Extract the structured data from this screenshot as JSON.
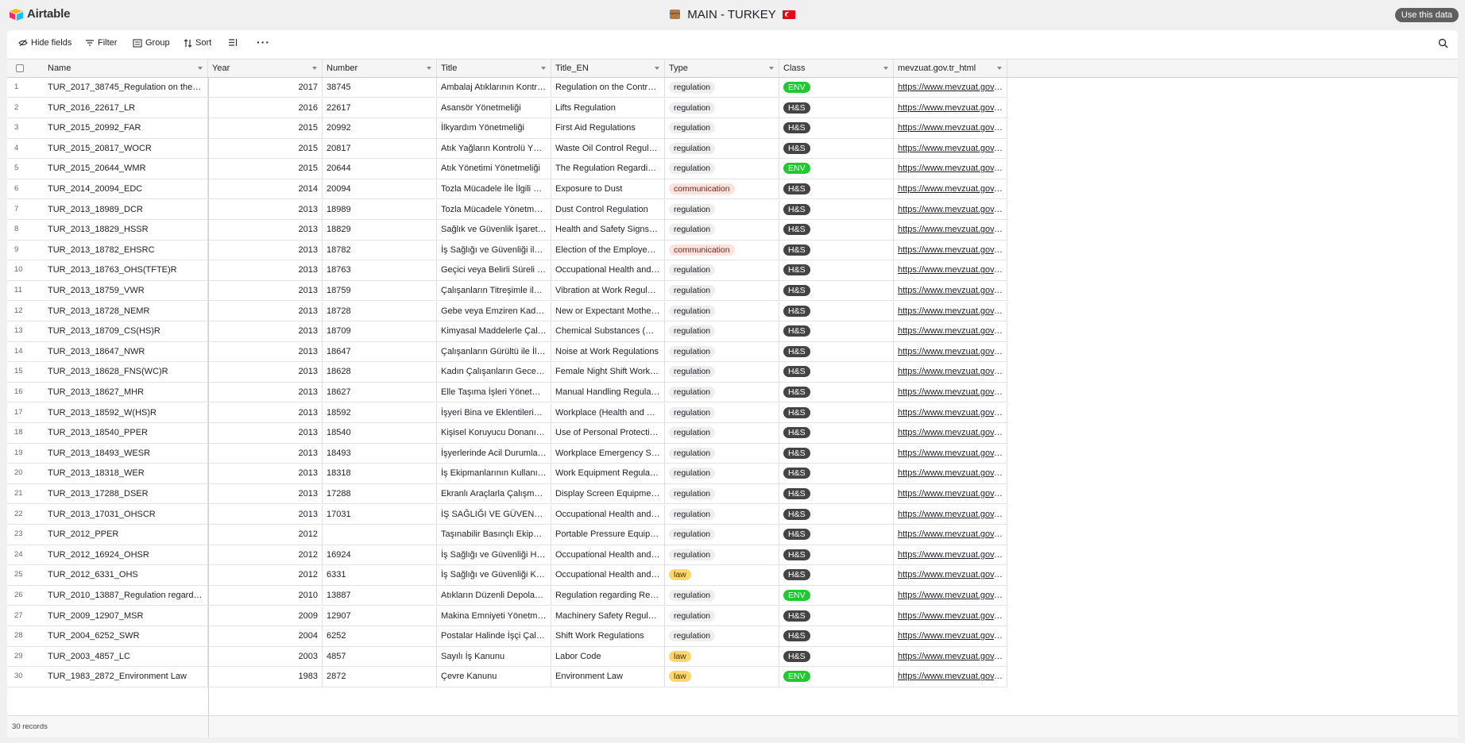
{
  "app": {
    "logo_text": "Airtable"
  },
  "base": {
    "title": "MAIN - TURKEY",
    "use_data_label": "Use this data"
  },
  "toolbar": {
    "hide_fields": "Hide fields",
    "filter": "Filter",
    "group": "Group",
    "sort": "Sort"
  },
  "table": {
    "columns": [
      "Name",
      "Year",
      "Number",
      "Title",
      "Title_EN",
      "Type",
      "Class",
      "mevzuat.gov.tr_html"
    ],
    "rows": [
      {
        "n": "1",
        "name": "TUR_2017_38745_Regulation on the Co...",
        "year": "2017",
        "number": "38745",
        "title": "Ambalaj Atıklarının Kontrol...",
        "title_en": "Regulation on the Control o...",
        "type": "regulation",
        "class": "ENV",
        "url": "https://www.mevzuat.gov.t..."
      },
      {
        "n": "2",
        "name": "TUR_2016_22617_LR",
        "year": "2016",
        "number": "22617",
        "title": "Asansör Yönetmeliği",
        "title_en": "Lifts Regulation",
        "type": "regulation",
        "class": "H&S",
        "url": "https://www.mevzuat.gov.t..."
      },
      {
        "n": "3",
        "name": "TUR_2015_20992_FAR",
        "year": "2015",
        "number": "20992",
        "title": "İlkyardım Yönetmeliği",
        "title_en": "First Aid Regulations",
        "type": "regulation",
        "class": "H&S",
        "url": "https://www.mevzuat.gov.t..."
      },
      {
        "n": "4",
        "name": "TUR_2015_20817_WOCR",
        "year": "2015",
        "number": "20817",
        "title": "Atık Yağların Kontrolü Yöne...",
        "title_en": "Waste Oil Control Regulation",
        "type": "regulation",
        "class": "H&S",
        "url": "https://www.mevzuat.gov.t..."
      },
      {
        "n": "5",
        "name": "TUR_2015_20644_WMR",
        "year": "2015",
        "number": "20644",
        "title": "Atık Yönetimi Yönetmeliği",
        "title_en": "The Regulation Regarding t...",
        "type": "regulation",
        "class": "ENV",
        "url": "https://www.mevzuat.gov.t..."
      },
      {
        "n": "6",
        "name": "TUR_2014_20094_EDC",
        "year": "2014",
        "number": "20094",
        "title": "Tozla Mücadele İle İlgili Uy...",
        "title_en": "Exposure to Dust",
        "type": "communication",
        "class": "H&S",
        "url": "https://www.mevzuat.gov.t..."
      },
      {
        "n": "7",
        "name": "TUR_2013_18989_DCR",
        "year": "2013",
        "number": "18989",
        "title": "Tozla Mücadele Yönetmeliği",
        "title_en": "Dust Control Regulation",
        "type": "regulation",
        "class": "H&S",
        "url": "https://www.mevzuat.gov.t..."
      },
      {
        "n": "8",
        "name": "TUR_2013_18829_HSSR",
        "year": "2013",
        "number": "18829",
        "title": "Sağlık ve Güvenlik İşaretleri...",
        "title_en": "Health and Safety Signs Re...",
        "type": "regulation",
        "class": "H&S",
        "url": "https://www.mevzuat.gov.t..."
      },
      {
        "n": "9",
        "name": "TUR_2013_18782_EHSRC",
        "year": "2013",
        "number": "18782",
        "title": "İş Sağlığı ve Güvenliği ile il...",
        "title_en": "Election of the Employee H...",
        "type": "communication",
        "class": "H&S",
        "url": "https://www.mevzuat.gov.t..."
      },
      {
        "n": "10",
        "name": "TUR_2013_18763_OHS(TFTE)R",
        "year": "2013",
        "number": "18763",
        "title": "Geçici veya Belirli Süreli İşl...",
        "title_en": "Occupational Health and S...",
        "type": "regulation",
        "class": "H&S",
        "url": "https://www.mevzuat.gov.t..."
      },
      {
        "n": "11",
        "name": "TUR_2013_18759_VWR",
        "year": "2013",
        "number": "18759",
        "title": "Çalışanların Titreşimle ilgili...",
        "title_en": "Vibration at Work Regulatio...",
        "type": "regulation",
        "class": "H&S",
        "url": "https://www.mevzuat.gov.t..."
      },
      {
        "n": "12",
        "name": "TUR_2013_18728_NEMR",
        "year": "2013",
        "number": "18728",
        "title": "Gebe veya Emziren Kadınla...",
        "title_en": "New or Expectant Mothers ...",
        "type": "regulation",
        "class": "H&S",
        "url": "https://www.mevzuat.gov.t..."
      },
      {
        "n": "13",
        "name": "TUR_2013_18709_CS(HS)R",
        "year": "2013",
        "number": "18709",
        "title": "Kimyasal Maddelerle Çalış...",
        "title_en": "Chemical Substances (Hea...",
        "type": "regulation",
        "class": "H&S",
        "url": "https://www.mevzuat.gov.t..."
      },
      {
        "n": "14",
        "name": "TUR_2013_18647_NWR",
        "year": "2013",
        "number": "18647",
        "title": "Çalışanların Gürültü ile İlgili...",
        "title_en": "Noise at Work Regulations",
        "type": "regulation",
        "class": "H&S",
        "url": "https://www.mevzuat.gov.t..."
      },
      {
        "n": "15",
        "name": "TUR_2013_18628_FNS(WC)R",
        "year": "2013",
        "number": "18628",
        "title": "Kadın Çalışanların Gece Po...",
        "title_en": "Female Night Shift Workers...",
        "type": "regulation",
        "class": "H&S",
        "url": "https://www.mevzuat.gov.t..."
      },
      {
        "n": "16",
        "name": "TUR_2013_18627_MHR",
        "year": "2013",
        "number": "18627",
        "title": "Elle Taşıma İşleri Yönetmel...",
        "title_en": "Manual Handling Regulatio...",
        "type": "regulation",
        "class": "H&S",
        "url": "https://www.mevzuat.gov.t..."
      },
      {
        "n": "17",
        "name": "TUR_2013_18592_W(HS)R",
        "year": "2013",
        "number": "18592",
        "title": "İşyeri Bina ve Eklentilerinde...",
        "title_en": "Workplace (Health and Saf...",
        "type": "regulation",
        "class": "H&S",
        "url": "https://www.mevzuat.gov.t..."
      },
      {
        "n": "18",
        "name": "TUR_2013_18540_PPER",
        "year": "2013",
        "number": "18540",
        "title": "Kişisel Koruyucu Donanıml...",
        "title_en": "Use of Personal Protective ...",
        "type": "regulation",
        "class": "H&S",
        "url": "https://www.mevzuat.gov.t..."
      },
      {
        "n": "19",
        "name": "TUR_2013_18493_WESR",
        "year": "2013",
        "number": "18493",
        "title": "İşyerlerinde Acil Durumlar ...",
        "title_en": "Workplace Emergency Situ...",
        "type": "regulation",
        "class": "H&S",
        "url": "https://www.mevzuat.gov.t..."
      },
      {
        "n": "20",
        "name": "TUR_2013_18318_WER",
        "year": "2013",
        "number": "18318",
        "title": "İş Ekipmanlarının Kullanımı...",
        "title_en": "Work Equipment Regulations",
        "type": "regulation",
        "class": "H&S",
        "url": "https://www.mevzuat.gov.t..."
      },
      {
        "n": "21",
        "name": "TUR_2013_17288_DSER",
        "year": "2013",
        "number": "17288",
        "title": "Ekranlı Araçlarla Çalışmala...",
        "title_en": "Display Screen Equipment ...",
        "type": "regulation",
        "class": "H&S",
        "url": "https://www.mevzuat.gov.t..."
      },
      {
        "n": "22",
        "name": "TUR_2013_17031_OHSCR",
        "year": "2013",
        "number": "17031",
        "title": "İŞ SAĞLIĞI VE GÜVENLİĞİ ...",
        "title_en": "Occupational Health and S...",
        "type": "regulation",
        "class": "H&S",
        "url": "https://www.mevzuat.gov.t..."
      },
      {
        "n": "23",
        "name": "TUR_2012_PPER",
        "year": "2012",
        "number": "",
        "title": "Taşınabilir Basınçlı Ekipma...",
        "title_en": "Portable Pressure Equipme...",
        "type": "regulation",
        "class": "H&S",
        "url": "https://www.mevzuat.gov.t..."
      },
      {
        "n": "24",
        "name": "TUR_2012_16924_OHSR",
        "year": "2012",
        "number": "16924",
        "title": "İş Sağlığı ve Güvenliği Hiz...",
        "title_en": "Occupational Health and S...",
        "type": "regulation",
        "class": "H&S",
        "url": "https://www.mevzuat.gov.t..."
      },
      {
        "n": "25",
        "name": "TUR_2012_6331_OHS",
        "year": "2012",
        "number": "6331",
        "title": "İş Sağlığı ve Güvenliği Kanu...",
        "title_en": "Occupational Health and S...",
        "type": "law",
        "class": "H&S",
        "url": "https://www.mevzuat.gov.t..."
      },
      {
        "n": "26",
        "name": "TUR_2010_13887_Regulation regarding...",
        "year": "2010",
        "number": "13887",
        "title": "Atıkların Düzenli Depolanm...",
        "title_en": "Regulation regarding Regul...",
        "type": "regulation",
        "class": "ENV",
        "url": "https://www.mevzuat.gov.t..."
      },
      {
        "n": "27",
        "name": "TUR_2009_12907_MSR",
        "year": "2009",
        "number": "12907",
        "title": "Makina Emniyeti Yönetmeliği",
        "title_en": "Machinery Safety Regulatio...",
        "type": "regulation",
        "class": "H&S",
        "url": "https://www.mevzuat.gov.t..."
      },
      {
        "n": "28",
        "name": "TUR_2004_6252_SWR",
        "year": "2004",
        "number": "6252",
        "title": "Postalar Halinde İşçi Çalışt...",
        "title_en": "Shift Work Regulations",
        "type": "regulation",
        "class": "H&S",
        "url": "https://www.mevzuat.gov.t..."
      },
      {
        "n": "29",
        "name": "TUR_2003_4857_LC",
        "year": "2003",
        "number": "4857",
        "title": "Sayılı İş Kanunu",
        "title_en": "Labor Code",
        "type": "law",
        "class": "H&S",
        "url": "https://www.mevzuat.gov.t..."
      },
      {
        "n": "30",
        "name": "TUR_1983_2872_Environment Law",
        "year": "1983",
        "number": "2872",
        "title": "Çevre Kanunu",
        "title_en": "Environment Law",
        "type": "law",
        "class": "ENV",
        "url": "https://www.mevzuat.gov.t..."
      }
    ]
  },
  "footer": {
    "record_count": "30 records"
  },
  "colors": {
    "env": "#20c933",
    "hs": "#444444",
    "law": "#ffd66e",
    "communication": "#fde2dd",
    "regulation": "#eeeeee"
  },
  "icons": [
    "airtable-logo-icon",
    "box-icon",
    "turkey-flag-icon",
    "hide-fields-icon",
    "filter-icon",
    "group-icon",
    "sort-icon",
    "row-height-icon",
    "more-icon",
    "search-icon",
    "chevron-down-icon"
  ]
}
